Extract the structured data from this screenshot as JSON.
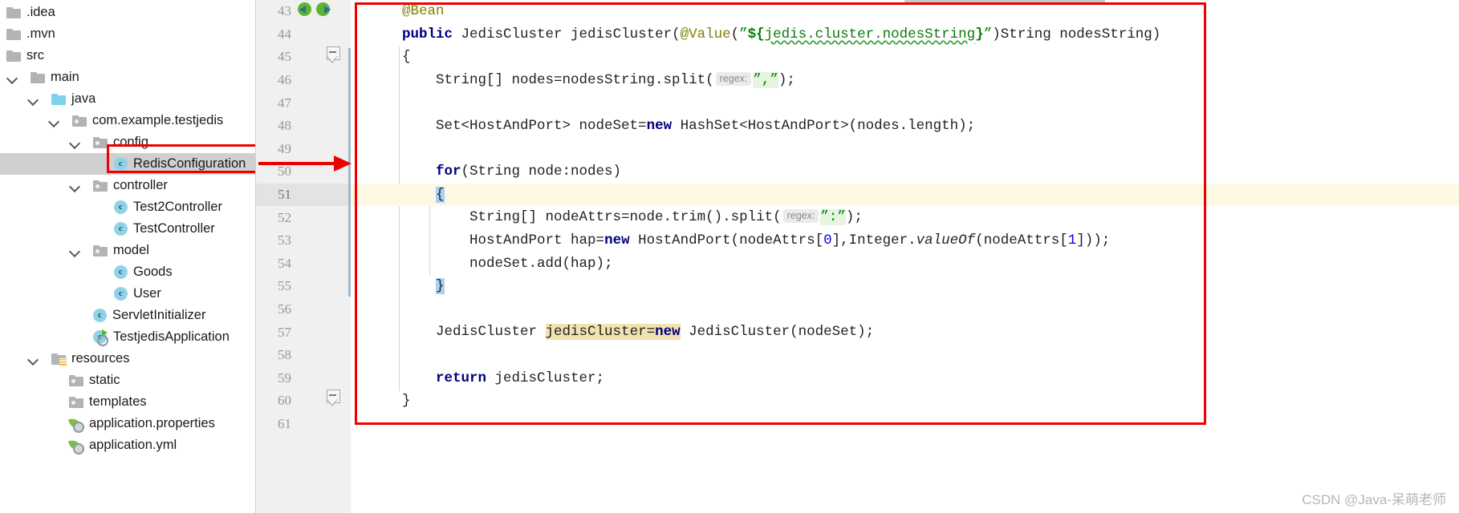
{
  "colors": {
    "highlight_box": "#ee0000",
    "arrow": "#ee0000",
    "selection": "#a6d2f4",
    "current_line": "#fdf8e3",
    "identifier_highlight": "#f2e2b0",
    "keyword": "#000080",
    "string": "#008000",
    "annotation": "#808000",
    "number": "#0000ee",
    "tree_selected_row": "#d0d0d0"
  },
  "project_tree": {
    "name": "project-tool-window",
    "items": [
      {
        "label": ".idea",
        "indent": 0,
        "icon": "folder-icon",
        "twisty": "none",
        "selected": false
      },
      {
        "label": ".mvn",
        "indent": 0,
        "icon": "folder-icon",
        "twisty": "none",
        "selected": false
      },
      {
        "label": "src",
        "indent": 0,
        "icon": "folder-icon",
        "twisty": "none",
        "selected": false
      },
      {
        "label": "main",
        "indent": 1,
        "icon": "folder-icon",
        "twisty": "expanded",
        "selected": false
      },
      {
        "label": "java",
        "indent": 2,
        "icon": "source-folder-icon",
        "twisty": "expanded",
        "selected": false
      },
      {
        "label": "com.example.testjedis",
        "indent": 3,
        "icon": "package-icon",
        "twisty": "expanded",
        "selected": false
      },
      {
        "label": "config",
        "indent": 4,
        "icon": "package-icon",
        "twisty": "expanded",
        "selected": false
      },
      {
        "label": "RedisConfiguration",
        "indent": 5,
        "icon": "java-class-icon",
        "twisty": "none",
        "selected": true
      },
      {
        "label": "controller",
        "indent": 4,
        "icon": "package-icon",
        "twisty": "expanded",
        "selected": false
      },
      {
        "label": "Test2Controller",
        "indent": 5,
        "icon": "java-class-icon",
        "twisty": "none",
        "selected": false
      },
      {
        "label": "TestController",
        "indent": 5,
        "icon": "java-class-icon",
        "twisty": "none",
        "selected": false
      },
      {
        "label": "model",
        "indent": 4,
        "icon": "package-icon",
        "twisty": "expanded",
        "selected": false
      },
      {
        "label": "Goods",
        "indent": 5,
        "icon": "java-class-icon",
        "twisty": "none",
        "selected": false
      },
      {
        "label": "User",
        "indent": 5,
        "icon": "java-class-icon",
        "twisty": "none",
        "selected": false
      },
      {
        "label": "ServletInitializer",
        "indent": 4,
        "icon": "java-class-icon",
        "twisty": "none",
        "selected": false
      },
      {
        "label": "TestjedisApplication",
        "indent": 4,
        "icon": "spring-run-class-icon",
        "twisty": "none",
        "selected": false
      },
      {
        "label": "resources",
        "indent": 2,
        "icon": "resources-folder-icon",
        "twisty": "expanded",
        "selected": false
      },
      {
        "label": "static",
        "indent": 3,
        "icon": "package-icon",
        "twisty": "none",
        "selected": false
      },
      {
        "label": "templates",
        "indent": 3,
        "icon": "package-icon",
        "twisty": "none",
        "selected": false
      },
      {
        "label": "application.properties",
        "indent": 3,
        "icon": "spring-properties-icon",
        "twisty": "none",
        "selected": false
      },
      {
        "label": "application.yml",
        "indent": 3,
        "icon": "spring-properties-icon",
        "twisty": "none",
        "selected": false
      }
    ]
  },
  "gutter": {
    "line_numbers": [
      "43",
      "44",
      "45",
      "46",
      "47",
      "48",
      "49",
      "50",
      "51",
      "52",
      "53",
      "54",
      "55",
      "56",
      "57",
      "58",
      "59",
      "60",
      "61"
    ],
    "current_line_number": "51",
    "run_icons": [
      "spring-bean-incoming-icon",
      "spring-bean-outgoing-icon"
    ],
    "fold_markers": [
      "fold-collapse-icon",
      "fold-collapse-icon"
    ]
  },
  "code": {
    "language": "java",
    "first_line": 43,
    "current_line": 51,
    "lines": [
      {
        "n": "43",
        "text": "    @Bean"
      },
      {
        "n": "44",
        "text": "    public JedisCluster jedisCluster(@Value(\"${jedis.cluster.nodesString}\")String nodesString)"
      },
      {
        "n": "45",
        "text": "    {"
      },
      {
        "n": "46",
        "text": "        String[] nodes=nodesString.split( regex: \",\");"
      },
      {
        "n": "47",
        "text": ""
      },
      {
        "n": "48",
        "text": "        Set<HostAndPort> nodeSet=new HashSet<HostAndPort>(nodes.length);"
      },
      {
        "n": "49",
        "text": ""
      },
      {
        "n": "50",
        "text": "        for(String node:nodes)"
      },
      {
        "n": "51",
        "text": "        {"
      },
      {
        "n": "52",
        "text": "            String[] nodeAttrs=node.trim().split( regex: \":\");"
      },
      {
        "n": "53",
        "text": "            HostAndPort hap=new HostAndPort(nodeAttrs[0],Integer.valueOf(nodeAttrs[1]));"
      },
      {
        "n": "54",
        "text": "            nodeSet.add(hap);"
      },
      {
        "n": "55",
        "text": "        }"
      },
      {
        "n": "56",
        "text": ""
      },
      {
        "n": "57",
        "text": "        JedisCluster jedisCluster=new JedisCluster(nodeSet);"
      },
      {
        "n": "58",
        "text": ""
      },
      {
        "n": "59",
        "text": "        return jedisCluster;"
      },
      {
        "n": "60",
        "text": "    }"
      },
      {
        "n": "61",
        "text": ""
      }
    ],
    "parameter_hints": [
      "regex:",
      "regex:"
    ],
    "highlighted_identifier": "jedisCluster",
    "selected_text": "{ }"
  },
  "annotations": {
    "tree_box_label": "red-highlight-around-RedisConfiguration",
    "arrow_label": "red-arrow-tree-to-code",
    "code_box_label": "red-highlight-around-jedisCluster-bean-method"
  },
  "watermark": {
    "text": "CSDN @Java-呆萌老师"
  }
}
